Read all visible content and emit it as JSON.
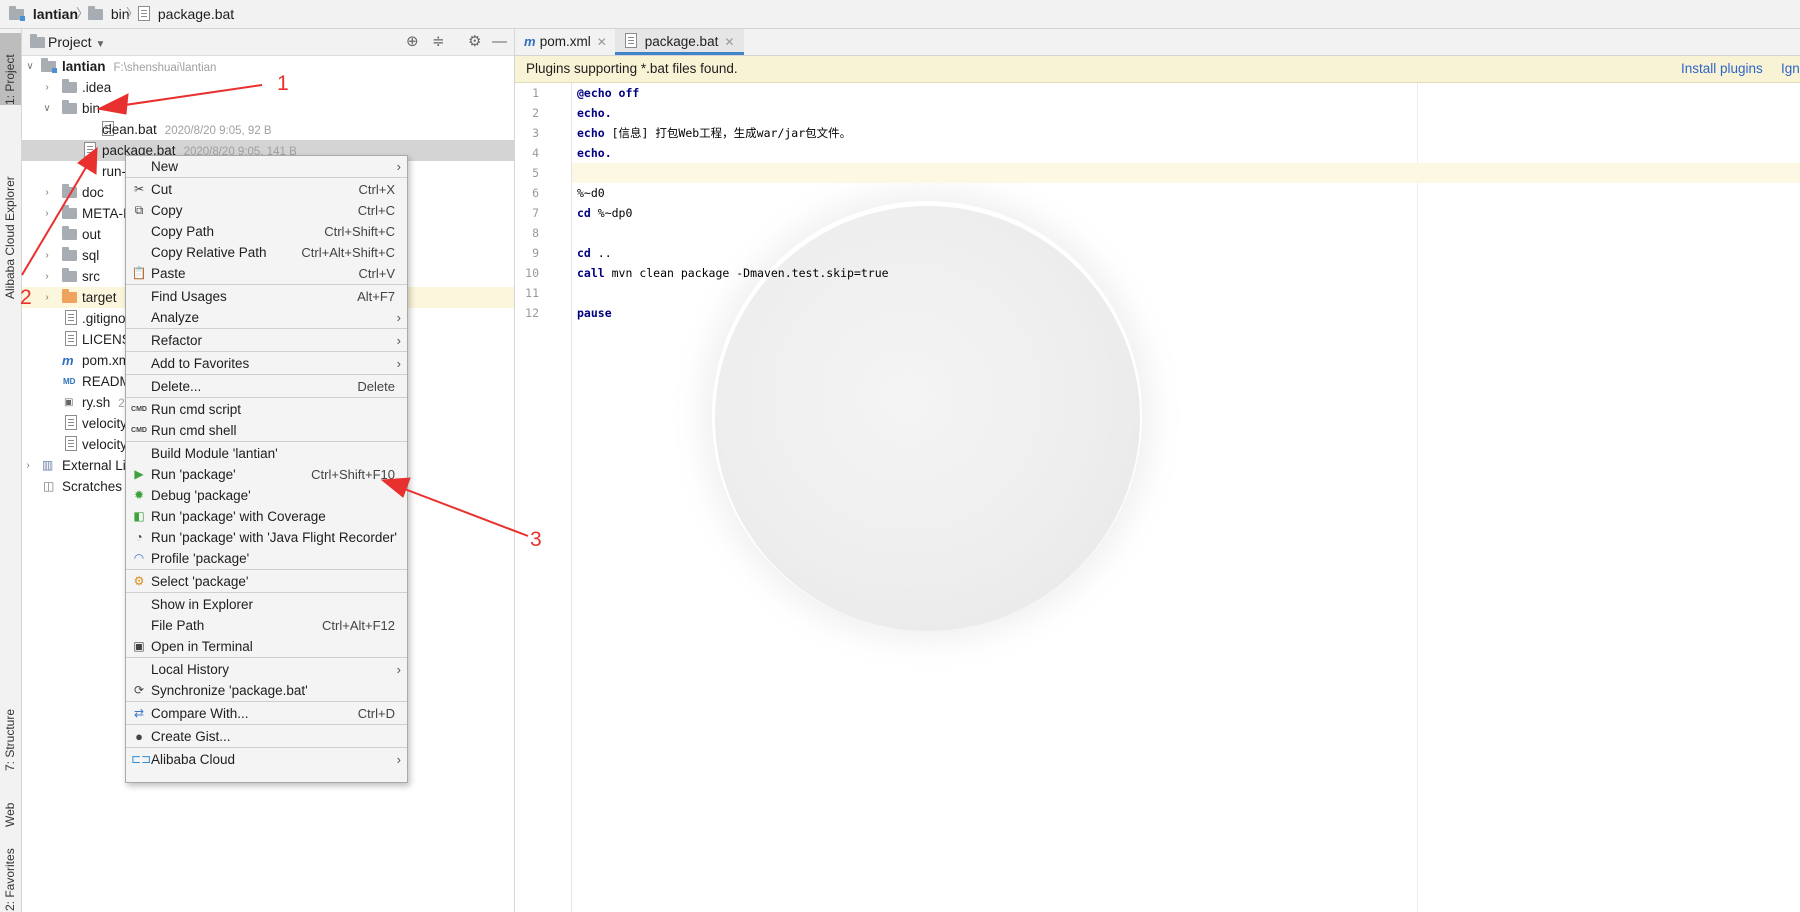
{
  "breadcrumb": [
    {
      "label": "lantian",
      "icon": "module-folder-icon"
    },
    {
      "label": "bin",
      "icon": "folder-icon"
    },
    {
      "label": "package.bat",
      "icon": "bat-file-icon"
    }
  ],
  "left_stripe": {
    "project": "1: Project",
    "alibaba": "Alibaba Cloud Explorer",
    "structure": "7: Structure",
    "web": "Web",
    "favorites": "2: Favorites"
  },
  "project_panel": {
    "title": "Project",
    "tree": [
      {
        "label": "lantian",
        "meta": "F:\\shenshuai\\lantian"
      },
      {
        "label": ".idea"
      },
      {
        "label": "bin"
      },
      {
        "label": "clean.bat",
        "meta": "2020/8/20 9:05, 92 B"
      },
      {
        "label": "package.bat",
        "meta": "2020/8/20 9:05, 141 B"
      },
      {
        "label": "run-"
      },
      {
        "label": "doc"
      },
      {
        "label": "META-I"
      },
      {
        "label": "out"
      },
      {
        "label": "sql"
      },
      {
        "label": "src"
      },
      {
        "label": "target"
      },
      {
        "label": ".gitigno"
      },
      {
        "label": "LICENSI"
      },
      {
        "label": "pom.xm"
      },
      {
        "label": "READM"
      },
      {
        "label": "ry.sh",
        "meta": "20"
      },
      {
        "label": "velocity"
      },
      {
        "label": "velocity"
      },
      {
        "label": "External Lib"
      },
      {
        "label": "Scratches a"
      }
    ]
  },
  "context_menu": [
    {
      "label": "New",
      "submenu": true
    },
    {
      "label": "Cut",
      "shortcut": "Ctrl+X",
      "icon": "cut-icon"
    },
    {
      "label": "Copy",
      "shortcut": "Ctrl+C",
      "icon": "copy-icon"
    },
    {
      "label": "Copy Path",
      "shortcut": "Ctrl+Shift+C"
    },
    {
      "label": "Copy Relative Path",
      "shortcut": "Ctrl+Alt+Shift+C"
    },
    {
      "label": "Paste",
      "shortcut": "Ctrl+V",
      "icon": "paste-icon"
    },
    {
      "label": "Find Usages",
      "shortcut": "Alt+F7"
    },
    {
      "label": "Analyze",
      "submenu": true
    },
    {
      "label": "Refactor",
      "submenu": true
    },
    {
      "label": "Add to Favorites",
      "submenu": true
    },
    {
      "label": "Delete...",
      "shortcut": "Delete"
    },
    {
      "label": "Run cmd script",
      "icon": "cmd-icon"
    },
    {
      "label": "Run cmd shell",
      "icon": "cmd-icon"
    },
    {
      "label": "Build Module 'lantian'"
    },
    {
      "label": "Run 'package'",
      "shortcut": "Ctrl+Shift+F10",
      "icon": "run-icon"
    },
    {
      "label": "Debug 'package'",
      "icon": "debug-icon"
    },
    {
      "label": "Run 'package' with Coverage",
      "icon": "coverage-icon"
    },
    {
      "label": "Run 'package' with 'Java Flight Recorder'",
      "icon": "jfr-icon"
    },
    {
      "label": "Profile 'package'",
      "icon": "profile-icon"
    },
    {
      "label": "Select 'package'",
      "icon": "select-config-icon"
    },
    {
      "label": "Show in Explorer"
    },
    {
      "label": "File Path",
      "shortcut": "Ctrl+Alt+F12"
    },
    {
      "label": "Open in Terminal",
      "icon": "terminal-icon"
    },
    {
      "label": "Local History",
      "submenu": true
    },
    {
      "label": "Synchronize 'package.bat'",
      "icon": "sync-icon"
    },
    {
      "label": "Compare With...",
      "shortcut": "Ctrl+D",
      "icon": "compare-icon"
    },
    {
      "label": "Create Gist...",
      "icon": "github-icon"
    },
    {
      "label": "Alibaba Cloud",
      "submenu": true,
      "icon": "alibaba-cloud-icon"
    }
  ],
  "editor_tabs": [
    {
      "label": "pom.xml",
      "active": false
    },
    {
      "label": "package.bat",
      "active": true
    }
  ],
  "plugin_bar": {
    "message": "Plugins supporting *.bat files found.",
    "install": "Install plugins",
    "ignore": "Ign"
  },
  "code_lines": [
    {
      "n": "1",
      "kw": "@echo",
      "rest": " off"
    },
    {
      "n": "2",
      "kw": "echo.",
      "rest": ""
    },
    {
      "n": "3",
      "kw": "echo",
      "rest": " [信息] 打包Web工程，生成war/jar包文件。"
    },
    {
      "n": "4",
      "kw": "echo.",
      "rest": ""
    },
    {
      "n": "5",
      "kw": "",
      "rest": ""
    },
    {
      "n": "6",
      "kw": "",
      "rest": "%~d0"
    },
    {
      "n": "7",
      "kw": "cd",
      "rest": " %~dp0"
    },
    {
      "n": "8",
      "kw": "",
      "rest": ""
    },
    {
      "n": "9",
      "kw": "cd",
      "rest": " .."
    },
    {
      "n": "10",
      "kw": "call",
      "rest": " mvn clean package -Dmaven.test.skip=true"
    },
    {
      "n": "11",
      "kw": "",
      "rest": ""
    },
    {
      "n": "12",
      "kw": "pause",
      "rest": ""
    }
  ],
  "annotations": [
    "1",
    "2",
    "3"
  ]
}
